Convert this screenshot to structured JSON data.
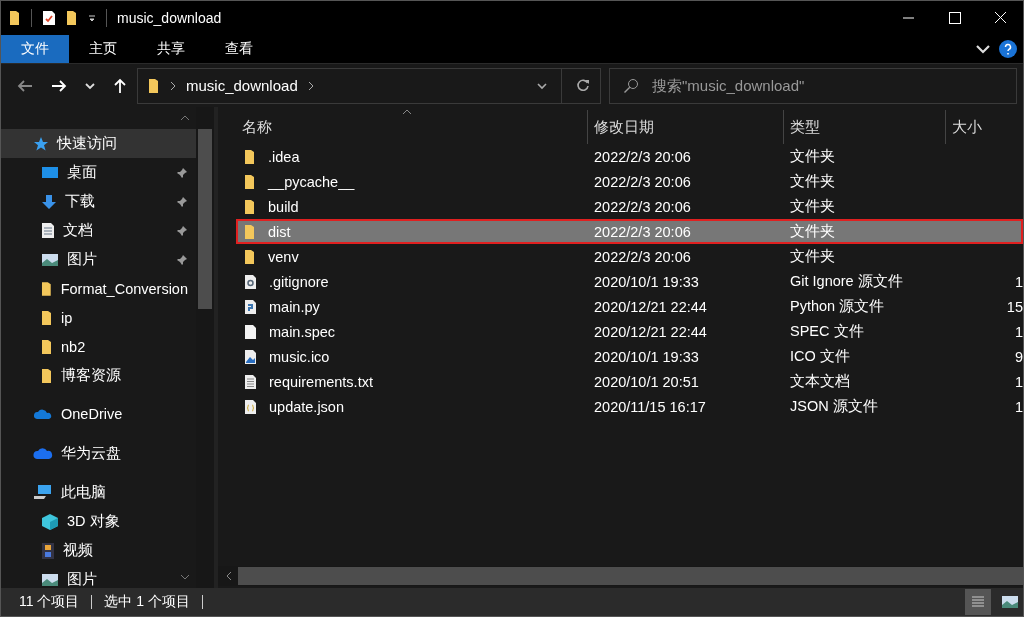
{
  "window": {
    "title": "music_download"
  },
  "ribbon_tabs": [
    {
      "label": "文件",
      "selected": true
    },
    {
      "label": "主页",
      "selected": false
    },
    {
      "label": "共享",
      "selected": false
    },
    {
      "label": "查看",
      "selected": false
    }
  ],
  "address": {
    "path": "music_download"
  },
  "search": {
    "placeholder": "搜索\"music_download\""
  },
  "sidebar": {
    "items": [
      {
        "kind": "quick",
        "label": "快速访问",
        "selected": true
      },
      {
        "kind": "desktop",
        "label": "桌面",
        "pinned": true,
        "selected": false
      },
      {
        "kind": "download",
        "label": "下载",
        "pinned": true,
        "selected": false
      },
      {
        "kind": "document",
        "label": "文档",
        "pinned": true,
        "selected": false
      },
      {
        "kind": "picture",
        "label": "图片",
        "pinned": true,
        "selected": false
      },
      {
        "kind": "folder",
        "label": "Format_Conversion",
        "pinned": false,
        "selected": false
      },
      {
        "kind": "folder",
        "label": "ip",
        "pinned": false,
        "selected": false
      },
      {
        "kind": "folder",
        "label": "nb2",
        "pinned": false,
        "selected": false
      },
      {
        "kind": "folder",
        "label": "博客资源",
        "pinned": false,
        "selected": false
      },
      {
        "kind": "onedrive",
        "label": "OneDrive",
        "selected": false
      },
      {
        "kind": "cloud",
        "label": "华为云盘",
        "selected": false
      },
      {
        "kind": "pc",
        "label": "此电脑",
        "selected": false
      },
      {
        "kind": "cube",
        "label": "3D 对象",
        "selected": false
      },
      {
        "kind": "video",
        "label": "视频",
        "selected": false
      },
      {
        "kind": "picture",
        "label": "图片",
        "selected": false
      }
    ]
  },
  "table": {
    "columns": [
      "名称",
      "修改日期",
      "类型",
      "大小"
    ],
    "rows": [
      {
        "kind": "folder",
        "name": ".idea",
        "date": "2022/2/3 20:06",
        "type": "文件夹",
        "selected": false
      },
      {
        "kind": "folder",
        "name": "__pycache__",
        "date": "2022/2/3 20:06",
        "type": "文件夹",
        "selected": false
      },
      {
        "kind": "folder",
        "name": "build",
        "date": "2022/2/3 20:06",
        "type": "文件夹",
        "selected": false
      },
      {
        "kind": "folder",
        "name": "dist",
        "date": "2022/2/3 20:06",
        "type": "文件夹",
        "selected": true
      },
      {
        "kind": "folder",
        "name": "venv",
        "date": "2022/2/3 20:06",
        "type": "文件夹",
        "selected": false
      },
      {
        "kind": "config",
        "name": ".gitignore",
        "date": "2020/10/1 19:33",
        "type": "Git Ignore 源文件",
        "size": "1",
        "selected": false
      },
      {
        "kind": "python",
        "name": "main.py",
        "date": "2020/12/21 22:44",
        "type": "Python 源文件",
        "size": "15",
        "selected": false
      },
      {
        "kind": "blank",
        "name": "main.spec",
        "date": "2020/12/21 22:44",
        "type": "SPEC 文件",
        "size": "1",
        "selected": false
      },
      {
        "kind": "image",
        "name": "music.ico",
        "date": "2020/10/1 19:33",
        "type": "ICO 文件",
        "size": "9",
        "selected": false
      },
      {
        "kind": "text",
        "name": "requirements.txt",
        "date": "2020/10/1 20:51",
        "type": "文本文档",
        "size": "1",
        "selected": false
      },
      {
        "kind": "json",
        "name": "update.json",
        "date": "2020/11/15 16:17",
        "type": "JSON 源文件",
        "size": "1",
        "selected": false
      }
    ]
  },
  "status_bar": {
    "count": "11 个项目",
    "selection": "选中 1 个项目"
  }
}
